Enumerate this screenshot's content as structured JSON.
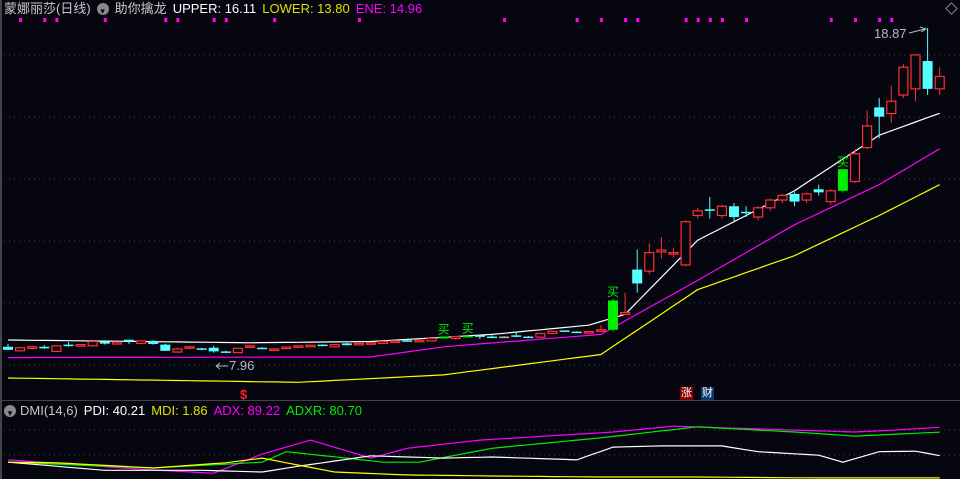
{
  "header": {
    "stock_name": "蒙娜丽莎(日线)",
    "indicator": "助你擒龙",
    "upper": "UPPER: 16.11",
    "lower": "LOWER: 13.80",
    "ene": "ENE: 14.96"
  },
  "dmi_header": {
    "name": "DMI(14,6)",
    "pdi": "PDI: 40.21",
    "mdi": "MDI: 1.86",
    "adx": "ADX: 89.22",
    "adxr": "ADXR: 80.70"
  },
  "annotations": {
    "high_label": "18.87",
    "low_label": "7.96",
    "buy_label": "买",
    "dollar": "$",
    "badge_zhang": "涨",
    "badge_cai": "财"
  },
  "colors": {
    "up": "#ff3030",
    "down": "#54ffff",
    "signal": "#00ee00",
    "upper": "#ffffff",
    "ene": "#ff00ff",
    "lower": "#ffff00",
    "pdi": "#ffffff",
    "mdi": "#ffff00",
    "adx": "#ff00ff",
    "adxr": "#00ee00"
  },
  "chart_data": [
    {
      "type": "candlestick",
      "title": "蒙娜丽莎(日线)",
      "ylim": [
        7.96,
        18.87
      ],
      "candles_ohlc": [
        [
          8.55,
          8.45,
          8.65,
          8.45
        ],
        [
          8.42,
          8.52,
          8.55,
          8.4
        ],
        [
          8.5,
          8.55,
          8.58,
          8.46
        ],
        [
          8.55,
          8.5,
          8.6,
          8.48
        ],
        [
          8.4,
          8.58,
          8.6,
          8.4
        ],
        [
          8.62,
          8.6,
          8.7,
          8.55
        ],
        [
          8.57,
          8.62,
          8.64,
          8.55
        ],
        [
          8.58,
          8.72,
          8.72,
          8.58
        ],
        [
          8.72,
          8.65,
          8.72,
          8.62
        ],
        [
          8.64,
          8.7,
          8.7,
          8.64
        ],
        [
          8.78,
          8.72,
          8.78,
          8.64
        ],
        [
          8.66,
          8.74,
          8.74,
          8.66
        ],
        [
          8.74,
          8.64,
          8.76,
          8.62
        ],
        [
          8.62,
          8.42,
          8.65,
          8.42
        ],
        [
          8.38,
          8.48,
          8.52,
          8.36
        ],
        [
          8.52,
          8.55,
          8.58,
          8.5
        ],
        [
          8.5,
          8.46,
          8.52,
          8.44
        ],
        [
          8.52,
          8.4,
          8.58,
          8.36
        ],
        [
          8.4,
          8.38,
          8.42,
          8.36
        ],
        [
          8.36,
          8.5,
          8.5,
          8.36
        ],
        [
          8.55,
          8.58,
          8.6,
          8.5
        ],
        [
          8.52,
          8.5,
          8.54,
          8.48
        ],
        [
          8.44,
          8.48,
          8.5,
          8.43
        ],
        [
          8.5,
          8.54,
          8.54,
          8.5
        ],
        [
          8.54,
          8.58,
          8.58,
          8.54
        ],
        [
          8.55,
          8.6,
          8.6,
          8.55
        ],
        [
          8.62,
          8.58,
          8.63,
          8.57
        ],
        [
          8.55,
          8.62,
          8.62,
          8.55
        ],
        [
          8.66,
          8.6,
          8.68,
          8.6
        ],
        [
          8.62,
          8.66,
          8.68,
          8.6
        ],
        [
          8.64,
          8.68,
          8.7,
          8.62
        ],
        [
          8.66,
          8.72,
          8.74,
          8.64
        ],
        [
          8.7,
          8.74,
          8.76,
          8.68
        ],
        [
          8.76,
          8.74,
          8.78,
          8.72
        ],
        [
          8.74,
          8.76,
          8.78,
          8.72
        ],
        [
          8.74,
          8.82,
          8.82,
          8.72
        ],
        [
          8.88,
          8.82,
          8.88,
          8.82
        ],
        [
          8.82,
          8.88,
          8.9,
          8.78
        ],
        [
          8.9,
          8.88,
          8.92,
          8.85
        ],
        [
          8.92,
          8.88,
          8.92,
          8.8
        ],
        [
          8.88,
          8.87,
          8.92,
          8.84
        ],
        [
          8.88,
          8.88,
          8.9,
          8.85
        ],
        [
          8.92,
          8.9,
          9.05,
          8.86
        ],
        [
          8.88,
          8.87,
          8.9,
          8.86
        ],
        [
          8.86,
          8.98,
          9.0,
          8.84
        ],
        [
          8.98,
          9.05,
          9.05,
          8.98
        ],
        [
          9.08,
          9.06,
          9.08,
          9.02
        ],
        [
          9.04,
          9.02,
          9.05,
          9.0
        ],
        [
          9.0,
          9.04,
          9.04,
          9.0
        ],
        [
          9.05,
          9.1,
          9.25,
          9.05
        ],
        [
          10.05,
          9.1,
          10.1,
          9.05
        ],
        [
          9.6,
          9.66,
          10.3,
          9.6
        ],
        [
          11.05,
          10.6,
          11.7,
          10.3
        ],
        [
          11.0,
          11.6,
          11.9,
          10.9
        ],
        [
          11.62,
          11.68,
          12.1,
          11.4
        ],
        [
          11.55,
          11.6,
          11.75,
          11.45
        ],
        [
          11.2,
          12.6,
          12.65,
          11.15
        ],
        [
          12.8,
          12.95,
          13.05,
          12.7
        ],
        [
          13.0,
          12.95,
          13.4,
          12.7
        ],
        [
          12.8,
          13.1,
          13.15,
          12.7
        ],
        [
          13.1,
          12.75,
          13.2,
          12.6
        ],
        [
          12.92,
          12.9,
          13.1,
          12.75
        ],
        [
          12.75,
          13.05,
          13.1,
          12.65
        ],
        [
          13.05,
          13.3,
          13.35,
          12.95
        ],
        [
          13.3,
          13.45,
          13.5,
          13.2
        ],
        [
          13.5,
          13.25,
          13.55,
          13.1
        ],
        [
          13.3,
          13.5,
          13.55,
          13.2
        ],
        [
          13.65,
          13.55,
          13.8,
          13.45
        ],
        [
          13.25,
          13.6,
          13.65,
          13.15
        ],
        [
          14.3,
          13.6,
          14.3,
          13.55
        ],
        [
          13.9,
          14.8,
          14.95,
          13.85
        ],
        [
          15.0,
          15.7,
          16.2,
          14.95
        ],
        [
          16.3,
          16.0,
          16.6,
          15.3
        ],
        [
          16.1,
          16.5,
          17.0,
          15.8
        ],
        [
          16.7,
          17.6,
          17.7,
          16.6
        ],
        [
          16.9,
          18.0,
          18.0,
          16.5
        ],
        [
          17.8,
          16.9,
          18.87,
          16.7
        ],
        [
          16.9,
          17.3,
          17.6,
          16.7
        ]
      ],
      "signal_candles": [
        36,
        38,
        50,
        69
      ],
      "buy_signals": [
        36,
        38,
        50,
        69
      ],
      "top_markers": [
        1,
        3,
        4,
        8,
        13,
        14,
        17,
        18,
        22,
        29,
        41,
        47,
        49,
        51,
        52,
        56,
        57,
        58,
        59,
        61,
        68,
        70,
        72,
        73
      ],
      "bands": {
        "upper": [
          [
            0,
            8.77
          ],
          [
            20,
            8.68
          ],
          [
            30,
            8.72
          ],
          [
            40,
            8.95
          ],
          [
            48,
            9.25
          ],
          [
            51,
            9.6
          ],
          [
            57,
            12.0
          ],
          [
            65,
            13.6
          ],
          [
            72,
            15.4
          ],
          [
            77,
            16.11
          ]
        ],
        "ene": [
          [
            0,
            8.2
          ],
          [
            30,
            8.22
          ],
          [
            36,
            8.55
          ],
          [
            49,
            8.95
          ],
          [
            57,
            10.7
          ],
          [
            65,
            12.5
          ],
          [
            72,
            13.8
          ],
          [
            77,
            14.96
          ]
        ],
        "lower": [
          [
            0,
            7.54
          ],
          [
            24,
            7.4
          ],
          [
            36,
            7.64
          ],
          [
            49,
            8.3
          ],
          [
            57,
            10.4
          ],
          [
            65,
            11.5
          ],
          [
            72,
            12.8
          ],
          [
            77,
            13.8
          ]
        ]
      }
    },
    {
      "type": "line",
      "title": "DMI(14,6)",
      "ylim": [
        0,
        100
      ],
      "series": [
        {
          "name": "ADX",
          "points": [
            [
              0,
              33
            ],
            [
              12,
              15.5
            ],
            [
              17,
              10
            ],
            [
              21,
              43
            ],
            [
              25,
              67
            ],
            [
              30,
              36
            ],
            [
              33,
              53
            ],
            [
              39,
              67
            ],
            [
              50,
              81
            ],
            [
              55,
              91
            ],
            [
              70,
              81
            ],
            [
              73,
              84
            ],
            [
              77,
              89.22
            ]
          ]
        },
        {
          "name": "ADXR",
          "points": [
            [
              0,
              29
            ],
            [
              12,
              19
            ],
            [
              21,
              29
            ],
            [
              23,
              47
            ],
            [
              28,
              36
            ],
            [
              31,
              29
            ],
            [
              34,
              29
            ],
            [
              40,
              53
            ],
            [
              49,
              71
            ],
            [
              57,
              90
            ],
            [
              65,
              81
            ],
            [
              70,
              74
            ],
            [
              77,
              80.7
            ]
          ]
        },
        {
          "name": "PDI",
          "points": [
            [
              0,
              29
            ],
            [
              8,
              15
            ],
            [
              16,
              15
            ],
            [
              21,
              12
            ],
            [
              24,
              22
            ],
            [
              27,
              31
            ],
            [
              30,
              40
            ],
            [
              36,
              36
            ],
            [
              40,
              38
            ],
            [
              47,
              33
            ],
            [
              50,
              55
            ],
            [
              54,
              57
            ],
            [
              59,
              57
            ],
            [
              62,
              47
            ],
            [
              67,
              41
            ],
            [
              69,
              29
            ],
            [
              72,
              47
            ],
            [
              75,
              48
            ],
            [
              77,
              40.21
            ]
          ]
        },
        {
          "name": "MDI",
          "points": [
            [
              0,
              29
            ],
            [
              4,
              28
            ],
            [
              12,
              19
            ],
            [
              18,
              28
            ],
            [
              21,
              36
            ],
            [
              24,
              24
            ],
            [
              27,
              12
            ],
            [
              33,
              7
            ],
            [
              41,
              5
            ],
            [
              49,
              3.4
            ],
            [
              57,
              3.4
            ],
            [
              65,
              2
            ],
            [
              77,
              1.86
            ]
          ]
        }
      ]
    }
  ]
}
